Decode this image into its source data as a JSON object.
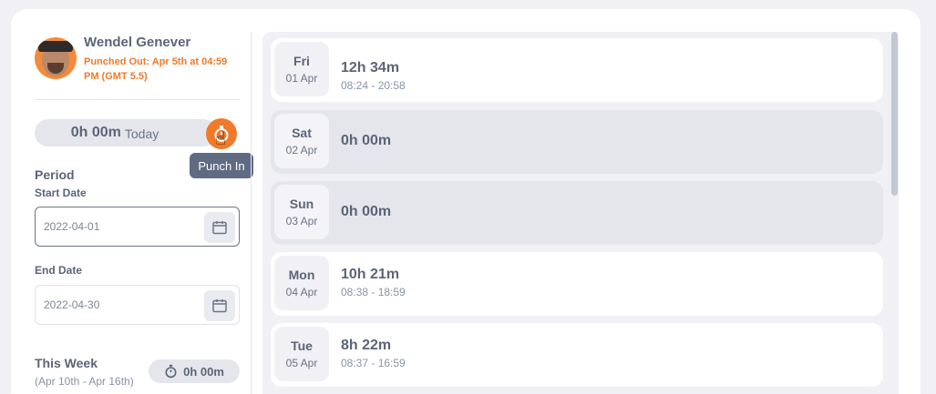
{
  "user": {
    "name": "Wendel Genever",
    "status": "Punched Out: Apr 5th at 04:59 PM (GMT 5.5)"
  },
  "today": {
    "hours": "0h 00m",
    "label": "Today",
    "punch_tooltip": "Punch In"
  },
  "period": {
    "title": "Period",
    "start_label": "Start Date",
    "start_value": "2022-04-01",
    "end_label": "End Date",
    "end_value": "2022-04-30"
  },
  "week": {
    "title": "This Week",
    "range": "(Apr 10th - Apr 16th)",
    "hours": "0h 00m"
  },
  "days": [
    {
      "day": "Fri",
      "date": "01 Apr",
      "hours": "12h 34m",
      "range": "08:24 - 20:58"
    },
    {
      "day": "Sat",
      "date": "02 Apr",
      "hours": "0h 00m",
      "range": ""
    },
    {
      "day": "Sun",
      "date": "03 Apr",
      "hours": "0h 00m",
      "range": ""
    },
    {
      "day": "Mon",
      "date": "04 Apr",
      "hours": "10h 21m",
      "range": "08:38 - 18:59"
    },
    {
      "day": "Tue",
      "date": "05 Apr",
      "hours": "8h 22m",
      "range": "08:37 - 16:59"
    }
  ],
  "colors": {
    "accent": "#f07a2a",
    "text": "#5b6577",
    "pill": "#e4e6ec"
  }
}
